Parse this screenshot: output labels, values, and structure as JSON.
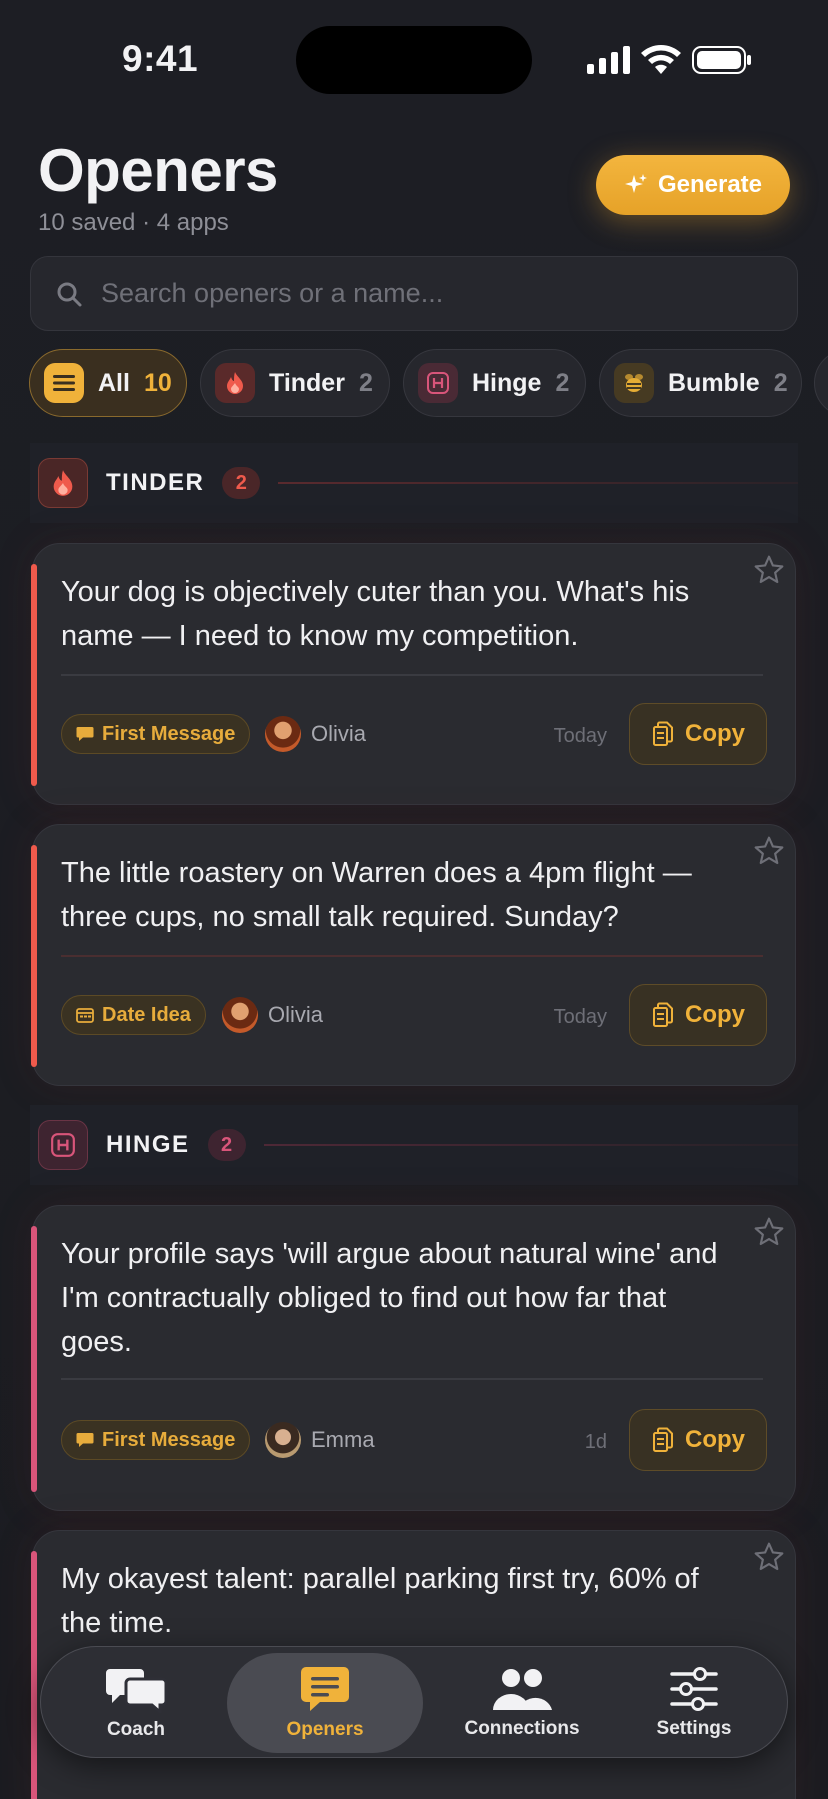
{
  "status": {
    "time": "9:41"
  },
  "header": {
    "title": "Openers",
    "subtitle": "10 saved · 4 apps",
    "generate_label": "Generate"
  },
  "search": {
    "placeholder": "Search openers or a name..."
  },
  "filters": [
    {
      "label": "All",
      "count": "10",
      "icon": "list-icon"
    },
    {
      "label": "Tinder",
      "count": "2",
      "icon": "flame-icon"
    },
    {
      "label": "Hinge",
      "count": "2",
      "icon": "hinge-icon"
    },
    {
      "label": "Bumble",
      "count": "2",
      "icon": "bee-icon"
    }
  ],
  "sections": [
    {
      "name": "TINDER",
      "count": "2"
    },
    {
      "name": "HINGE",
      "count": "2"
    }
  ],
  "cards": [
    {
      "message": "Your dog is objectively cuter than you. What's his name — I need to know my competition.",
      "tag": "First Message",
      "tag_icon": "chat-bubble-icon",
      "person": "Olivia",
      "when": "Today",
      "copy": "Copy"
    },
    {
      "message": "The little roastery on Warren does a 4pm flight — three cups, no small talk required. Sunday?",
      "tag": "Date Idea",
      "tag_icon": "calendar-icon",
      "person": "Olivia",
      "when": "Today",
      "copy": "Copy"
    },
    {
      "message": "Your profile says 'will argue about natural wine' and I'm contractually obliged to find out how far that goes.",
      "tag": "First Message",
      "tag_icon": "chat-bubble-icon",
      "person": "Emma",
      "when": "1d",
      "copy": "Copy"
    },
    {
      "message": "My okayest talent: parallel parking first try, 60% of the time.",
      "tag": "",
      "person": "",
      "when": "",
      "copy": ""
    }
  ],
  "tabbar": [
    {
      "label": "Coach",
      "icon": "chat-bubbles-icon"
    },
    {
      "label": "Openers",
      "icon": "message-icon"
    },
    {
      "label": "Connections",
      "icon": "people-icon"
    },
    {
      "label": "Settings",
      "icon": "sliders-icon"
    }
  ],
  "colors": {
    "accent": "#f0b23a",
    "tinder": "#ef5a4c",
    "hinge": "#d9557a",
    "bumble": "#e6ad35",
    "background": "#1c1d22"
  }
}
